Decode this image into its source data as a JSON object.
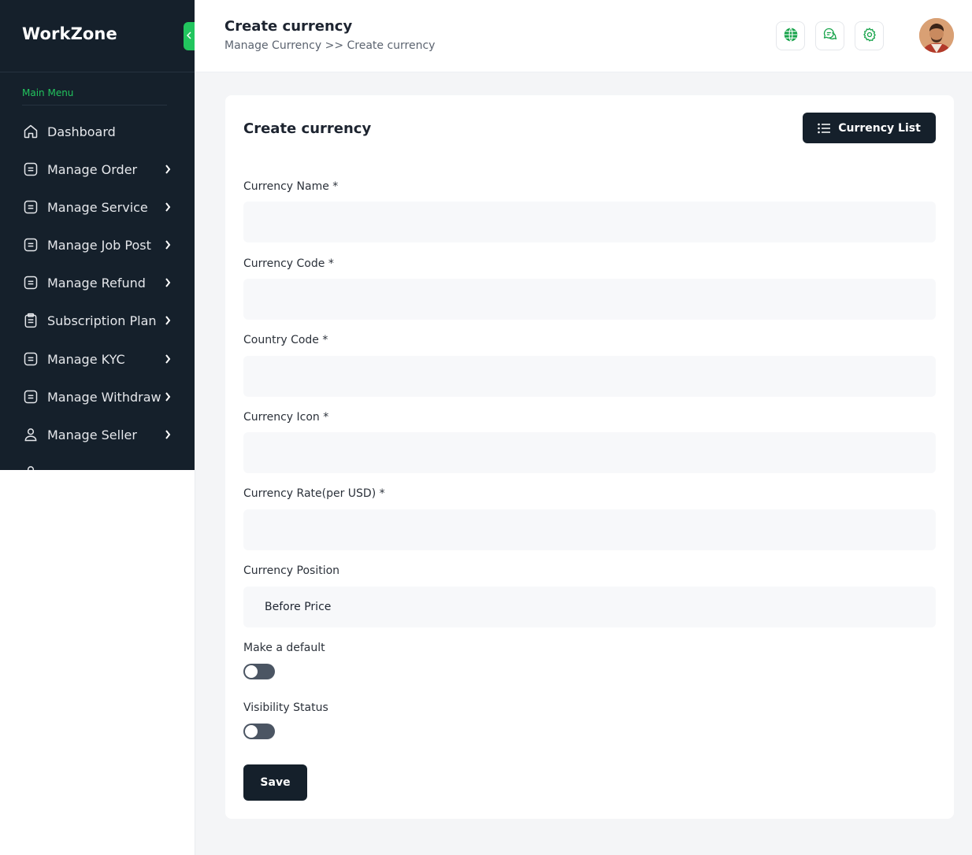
{
  "sidebar": {
    "brand": "WorkZone",
    "collapse_icon": "chevron-left-icon",
    "menu_heading": "Main Menu",
    "items": [
      {
        "label": "Dashboard",
        "icon": "home-icon",
        "has_submenu": false
      },
      {
        "label": "Manage Order",
        "icon": "document-icon",
        "has_submenu": true
      },
      {
        "label": "Manage Service",
        "icon": "document-icon",
        "has_submenu": true
      },
      {
        "label": "Manage Job Post",
        "icon": "document-icon",
        "has_submenu": true
      },
      {
        "label": "Manage Refund",
        "icon": "document-icon",
        "has_submenu": true
      },
      {
        "label": "Subscription Plan",
        "icon": "clipboard-icon",
        "has_submenu": true
      },
      {
        "label": "Manage KYC",
        "icon": "document-icon",
        "has_submenu": true
      },
      {
        "label": "Manage Withdraw",
        "icon": "document-icon",
        "has_submenu": true
      },
      {
        "label": "Manage Seller",
        "icon": "user-icon",
        "has_submenu": true
      }
    ]
  },
  "header": {
    "title": "Create currency",
    "breadcrumb": "Manage Currency >> Create currency",
    "icons": [
      "globe-icon",
      "chat-icon",
      "gear-icon"
    ],
    "avatar": "user-avatar"
  },
  "form": {
    "title": "Create currency",
    "list_button": "Currency List",
    "list_button_icon": "list-icon",
    "fields": [
      {
        "label": "Currency Name *",
        "value": ""
      },
      {
        "label": "Currency Code *",
        "value": ""
      },
      {
        "label": "Country Code *",
        "value": ""
      },
      {
        "label": "Currency Icon *",
        "value": ""
      },
      {
        "label": "Currency Rate(per USD) *",
        "value": ""
      }
    ],
    "position": {
      "label": "Currency Position",
      "selected": "Before Price"
    },
    "make_default": {
      "label": "Make a default",
      "on": false
    },
    "visibility": {
      "label": "Visibility Status",
      "on": false
    },
    "save": "Save"
  },
  "colors": {
    "accent": "#22c55e",
    "sidebar_bg": "#15202b",
    "button_bg": "#15202b",
    "page_bg": "#f4f5f7",
    "toggle_off": "#4b5563"
  }
}
